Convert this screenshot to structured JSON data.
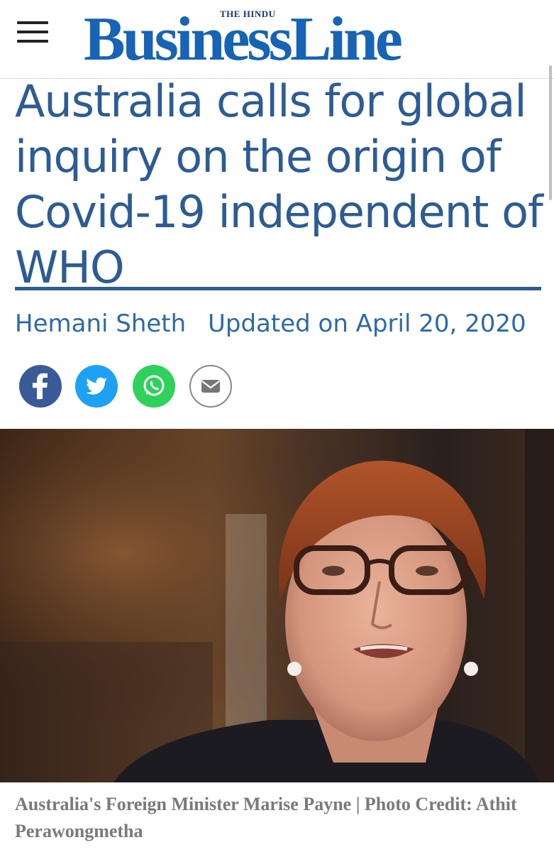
{
  "header": {
    "menu_icon": "hamburger-menu-icon",
    "logo_top": "THE HINDU",
    "logo_main": "BusinessLine"
  },
  "article": {
    "headline": "Australia calls for global inquiry on the origin of Covid-19 independent of WHO",
    "author": "Hemani Sheth",
    "updated": "Updated on April 20, 2020"
  },
  "share": [
    {
      "name": "facebook",
      "icon": "facebook-icon",
      "color": "#3b5a9a"
    },
    {
      "name": "twitter",
      "icon": "twitter-icon",
      "color": "#1da1f2"
    },
    {
      "name": "whatsapp",
      "icon": "whatsapp-icon",
      "color": "#2fd15a"
    },
    {
      "name": "email",
      "icon": "email-icon",
      "color": "#ffffff"
    }
  ],
  "photo": {
    "caption": "Australia's Foreign Minister Marise Payne | Photo Credit: Athit Perawongmetha"
  },
  "colors": {
    "brand": "#1763b5",
    "headline": "#2c5c93",
    "byline": "#2c6aa7",
    "caption": "#7a7a7a"
  }
}
